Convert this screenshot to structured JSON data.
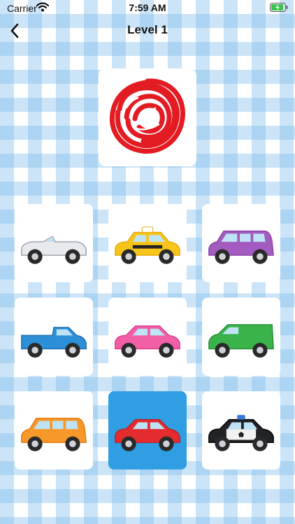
{
  "status_bar": {
    "carrier": "Carrier",
    "time": "7:59 AM"
  },
  "nav": {
    "title": "Level 1"
  },
  "target": {
    "color_name": "red",
    "color": "#e31b23"
  },
  "cars": [
    {
      "name": "convertible",
      "color": "#e9eaee",
      "accent": "#c9ccd3",
      "selected": false
    },
    {
      "name": "taxi",
      "color": "#f7c51a",
      "accent": "#e6a90c",
      "selected": false
    },
    {
      "name": "suv",
      "color": "#a35bbf",
      "accent": "#8a45a8",
      "selected": false
    },
    {
      "name": "pickup-truck",
      "color": "#2d8fd6",
      "accent": "#1f6fb0",
      "selected": false
    },
    {
      "name": "hatchback",
      "color": "#f15fa6",
      "accent": "#d93e88",
      "selected": false
    },
    {
      "name": "van",
      "color": "#3ab34a",
      "accent": "#2a8e37",
      "selected": false
    },
    {
      "name": "station-wagon",
      "color": "#f6982a",
      "accent": "#e3790f",
      "selected": false
    },
    {
      "name": "sedan",
      "color": "#e42b2f",
      "accent": "#c01f23",
      "selected": true
    },
    {
      "name": "police-car",
      "color": "#222327",
      "accent": "#f2f2f2",
      "selected": false
    }
  ]
}
